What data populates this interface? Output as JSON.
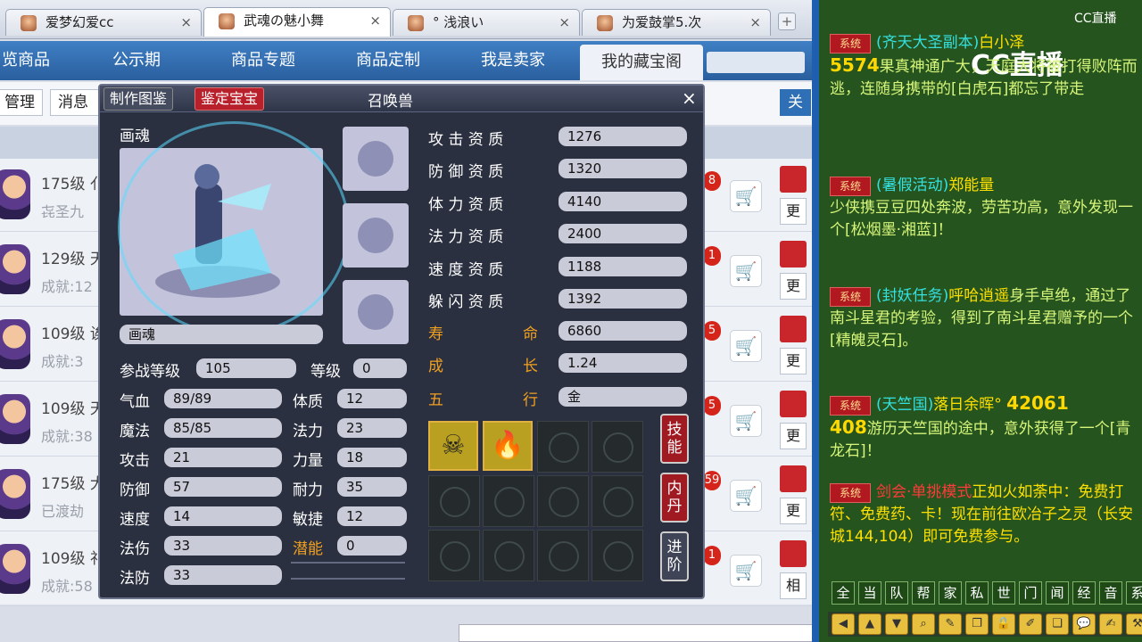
{
  "browser": {
    "tabs": [
      {
        "label": "爱梦幻爱cc"
      },
      {
        "label": "武魂の魅小舞"
      },
      {
        "label": "° 浅浪い"
      },
      {
        "label": "为爱鼓掌5.次"
      }
    ],
    "close_glyph": "×",
    "new_tab_glyph": "+"
  },
  "nav": {
    "items": [
      "览商品",
      "公示期",
      "商品专题",
      "商品定制",
      "我是卖家",
      "我的藏宝阁"
    ]
  },
  "subbar": {
    "manage": "管理",
    "message": "消息提",
    "right_btn": "关"
  },
  "list": {
    "rows": [
      {
        "level": "175级",
        "name2": "亻",
        "sub": "㐂圣九",
        "badge": "8",
        "more": "更"
      },
      {
        "level": "129级",
        "name2": "天",
        "sub": "成就:12",
        "badge": "1",
        "more": "更"
      },
      {
        "level": "109级",
        "name2": "诶",
        "sub": "成就:3",
        "badge": "5",
        "more": "更"
      },
      {
        "level": "109级",
        "name2": "天",
        "sub": "成就:38",
        "badge": "5",
        "more": "更"
      },
      {
        "level": "175级",
        "name2": "大",
        "sub": "已渡劫",
        "badge": "59",
        "more": "更"
      },
      {
        "level": "109级",
        "name2": "祁",
        "sub": "成就:58",
        "badge": "1",
        "more": "相"
      }
    ]
  },
  "dialog": {
    "title": "召唤兽",
    "tab1": "制作图鉴",
    "tab2": "鉴定宝宝",
    "close": "×",
    "pet_label": "画魂",
    "pet_name": "画魂",
    "battle_level_label": "参战等级",
    "battle_level": "105",
    "level_label": "等级",
    "level": "0",
    "left_stats": [
      {
        "label": "气血",
        "value": "89/89"
      },
      {
        "label": "魔法",
        "value": "85/85"
      },
      {
        "label": "攻击",
        "value": "21"
      },
      {
        "label": "防御",
        "value": "57"
      },
      {
        "label": "速度",
        "value": "14"
      },
      {
        "label": "法伤",
        "value": "33"
      },
      {
        "label": "法防",
        "value": "33"
      }
    ],
    "right_stats": [
      {
        "label": "体质",
        "value": "12"
      },
      {
        "label": "法力",
        "value": "23"
      },
      {
        "label": "力量",
        "value": "18"
      },
      {
        "label": "耐力",
        "value": "35"
      },
      {
        "label": "敏捷",
        "value": "12"
      },
      {
        "label": "潜能",
        "value": "0"
      }
    ],
    "aptitudes": [
      {
        "label": "攻 击 资 质",
        "value": "1276"
      },
      {
        "label": "防 御 资 质",
        "value": "1320"
      },
      {
        "label": "体 力 资 质",
        "value": "4140"
      },
      {
        "label": "法 力 资 质",
        "value": "2400"
      },
      {
        "label": "速 度 资 质",
        "value": "1188"
      },
      {
        "label": "躲 闪 资 质",
        "value": "1392"
      }
    ],
    "life": {
      "a": "寿",
      "b": "命",
      "value": "6860"
    },
    "growth": {
      "a": "成",
      "b": "长",
      "value": "1.24"
    },
    "element": {
      "a": "五",
      "b": "行",
      "value": "金"
    },
    "buttons": {
      "skills": "技能",
      "core": "内丹",
      "advance": "进阶"
    },
    "skill_icons": [
      "skull-skill-icon",
      "fire-skill-icon"
    ]
  },
  "chat": {
    "logo": "CC直播",
    "logo_small": "CC直播",
    "sys_tag": "系统",
    "messages": [
      {
        "pre": "(齐天大圣副本)",
        "name": "白小泽",
        "body": "果真神通广大，天庭大将被打得败阵而逃，连随身携带的[白虎石]都忘了带走",
        "num": "5574"
      },
      {
        "pre": "(暑假活动)",
        "name": "郑能量",
        "body": "少侠携豆豆四处奔波，劳苦功高，意外发现一个[松烟墨·湘蓝]！"
      },
      {
        "pre": "(封妖任务)",
        "name": "呼哈逍遥",
        "body": "身手卓绝，通过了南斗星君的考验，得到了南斗星君赠予的一个[精魄灵石]。"
      },
      {
        "pre": "(天竺国)",
        "name": "落日余晖°",
        "num": "42061",
        "num2": "408",
        "body": "游历天竺国的途中，意外获得了一个[青龙石]！"
      },
      {
        "pre": "剑会·",
        "name": "单挑模式",
        "body": "正如火如荼中：免费打符、免费药、卡！现在前往欧冶子之灵（长安城144,104）即可免费参与。"
      }
    ],
    "channels": [
      "全",
      "当",
      "队",
      "帮",
      "家",
      "私",
      "世",
      "门",
      "闻",
      "经",
      "音",
      "系"
    ]
  },
  "colors": {
    "nav": "#3f7fc4",
    "chat_bg": "#26541e",
    "dialog_bg": "#2b3040",
    "gold": "#f0a020"
  }
}
